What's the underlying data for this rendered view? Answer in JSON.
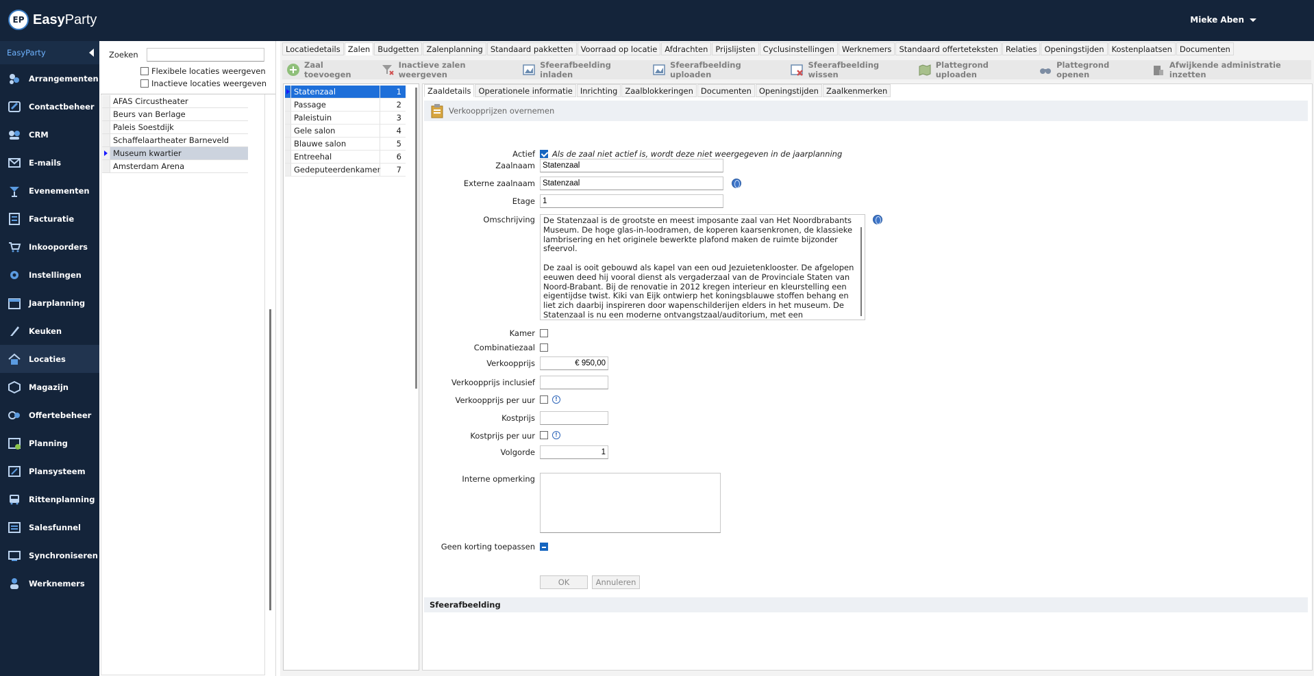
{
  "app": {
    "logo_badge": "EP",
    "logo_word_a": "Easy",
    "logo_word_b": "Party",
    "user": "Mieke Aben"
  },
  "sidebar": {
    "header": "EasyParty",
    "items": [
      {
        "label": "Arrangementen",
        "icon": "party-icon"
      },
      {
        "label": "Contactbeheer",
        "icon": "contact-icon"
      },
      {
        "label": "CRM",
        "icon": "crm-icon"
      },
      {
        "label": "E-mails",
        "icon": "mail-icon"
      },
      {
        "label": "Evenementen",
        "icon": "cocktail-icon"
      },
      {
        "label": "Facturatie",
        "icon": "invoice-icon"
      },
      {
        "label": "Inkooporders",
        "icon": "cart-icon"
      },
      {
        "label": "Instellingen",
        "icon": "gear-icon"
      },
      {
        "label": "Jaarplanning",
        "icon": "calendar-icon"
      },
      {
        "label": "Keuken",
        "icon": "knife-icon"
      },
      {
        "label": "Locaties",
        "icon": "house-icon"
      },
      {
        "label": "Magazijn",
        "icon": "box-icon"
      },
      {
        "label": "Offertebeheer",
        "icon": "quote-icon"
      },
      {
        "label": "Planning",
        "icon": "planning-icon"
      },
      {
        "label": "Plansysteem",
        "icon": "plansystem-icon"
      },
      {
        "label": "Rittenplanning",
        "icon": "bus-icon"
      },
      {
        "label": "Salesfunnel",
        "icon": "funnel-icon"
      },
      {
        "label": "Synchroniseren",
        "icon": "sync-icon"
      },
      {
        "label": "Werknemers",
        "icon": "worker-icon"
      }
    ]
  },
  "locations": {
    "search_label": "Zoeken",
    "search_value": "",
    "check_flexible": "Flexibele locaties weergeven",
    "check_inactive": "Inactieve locaties weergeven",
    "list": [
      "AFAS Circustheater",
      "Beurs van Berlage",
      "Paleis Soestdijk",
      "Schaffelaartheater Barneveld",
      "Museum kwartier",
      "Amsterdam Arena"
    ]
  },
  "main_tabs": [
    "Locatiedetails",
    "Zalen",
    "Budgetten",
    "Zalenplanning",
    "Standaard pakketten",
    "Voorraad op locatie",
    "Afdrachten",
    "Prijslijsten",
    "Cyclusinstellingen",
    "Werknemers",
    "Standaard offerteteksten",
    "Relaties",
    "Openingstijden",
    "Kostenplaatsen",
    "Documenten"
  ],
  "toolbar": [
    {
      "label": "Zaal toevoegen",
      "icon": "add-icon"
    },
    {
      "label": "Inactieve zalen weergeven",
      "icon": "filter-remove-icon"
    },
    {
      "label": "Sfeerafbeelding inladen",
      "icon": "image-load-icon"
    },
    {
      "label": "Sfeerafbeelding uploaden",
      "icon": "image-upload-icon"
    },
    {
      "label": "Sfeerafbeelding wissen",
      "icon": "image-delete-icon"
    },
    {
      "label": "Plattegrond uploaden",
      "icon": "map-upload-icon"
    },
    {
      "label": "Plattegrond openen",
      "icon": "binoculars-icon"
    },
    {
      "label": "Afwijkende administratie inzetten",
      "icon": "admin-icon"
    }
  ],
  "rooms": [
    {
      "name": "Statenzaal",
      "num": "1"
    },
    {
      "name": "Passage",
      "num": "2"
    },
    {
      "name": "Paleistuin",
      "num": "3"
    },
    {
      "name": "Gele salon",
      "num": "4"
    },
    {
      "name": "Blauwe salon",
      "num": "5"
    },
    {
      "name": "Entreehal",
      "num": "6"
    },
    {
      "name": "Gedeputeerdenkamer",
      "num": "7"
    }
  ],
  "detail_tabs": [
    "Zaaldetails",
    "Operationele informatie",
    "Inrichting",
    "Zaalblokkeringen",
    "Documenten",
    "Openingstijden",
    "Zaalkenmerken"
  ],
  "form": {
    "verkoop_overnemen": "Verkoopprijzen overnemen",
    "actief_label": "Actief",
    "actief_hint": "Als de zaal niet actief is, wordt deze niet weergegeven in de jaarplanning",
    "zaalnaam_label": "Zaalnaam",
    "zaalnaam_value": "Statenzaal",
    "extern_label": "Externe zaalnaam",
    "extern_value": "Statenzaal",
    "etage_label": "Etage",
    "etage_value": "1",
    "omschrijving_label": "Omschrijving",
    "omschrijving_p1": "De Statenzaal is de grootste en meest imposante zaal van Het Noordbrabants Museum. De hoge glas-in-loodramen, de koperen kaarsenkronen, de klassieke lambrisering en het originele bewerkte plafond maken de ruimte bijzonder sfeervol.",
    "omschrijving_p2": "De zaal is ooit gebouwd als kapel van een oud Jezuietenklooster. De afgelopen eeuwen deed hij vooral dienst als vergaderzaal van de Provinciale Staten van Noord-Brabant. Bij de renovatie in 2012 kregen interieur en kleurstelling een eigentijdse twist. Kiki van Eijk ontwierp het koningsblauwe stoffen behang en liet zich daarbij inspireren door wapenschilderijen elders in het museum. De Statenzaal is nu een moderne ontvangstzaal/auditorium, met een monumentaal",
    "kamer_label": "Kamer",
    "combinatie_label": "Combinatiezaal",
    "verkoopprijs_label": "Verkoopprijs",
    "verkoopprijs_value": "€ 950,00",
    "verkoop_incl_label": "Verkoopprijs inclusief",
    "verkoop_incl_value": "",
    "verkoop_uur_label": "Verkoopprijs per uur",
    "kostprijs_label": "Kostprijs",
    "kostprijs_value": "",
    "kostprijs_uur_label": "Kostprijs per uur",
    "volgorde_label": "Volgorde",
    "volgorde_value": "1",
    "interne_label": "Interne opmerking",
    "interne_value": "",
    "korting_label": "Geen korting toepassen",
    "ok": "OK",
    "annuleren": "Annuleren",
    "sfeer_section": "Sfeerafbeelding"
  },
  "colors": {
    "navy": "#14243a",
    "accent": "#1e6fd9"
  }
}
